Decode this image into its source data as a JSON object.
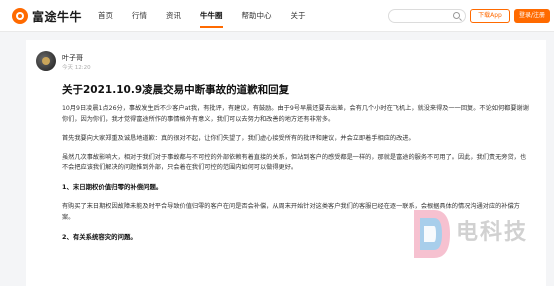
{
  "header": {
    "logo_text": "富途牛牛",
    "nav": [
      "首页",
      "行情",
      "资讯",
      "牛牛圈",
      "帮助中心",
      "关于"
    ],
    "search_placeholder": "",
    "download_label": "下载App",
    "login_label": "登录/注册"
  },
  "post": {
    "author": "叶子哥",
    "time": "今天 12:20",
    "title": "关于2021.10.9凌晨交易中断事故的道歉和回复",
    "paragraphs": [
      "10月9日凌晨1点26分，事故发生后不少客户at我，有批评，有建议，有鼓励。由于9号早晨还要去出差，会有几个小时在飞机上，就没来得及一一回复。不论如何都要谢谢你们，因为你们，我才觉得富途所作的事情格外有意义，我们可以去努力和改善的地方还有非常多。",
      "首先我要向大家郑重及诚恳地道歉：真的很对不起，让你们失望了，我们虚心接受所有的批评和建议，并会立即着手相应的改进。",
      "虽然几次事故影响大，相对于我们对于事故都与不可控的外部依赖有着直接的关系，但站到客户的感受都是一样的，那就是富途的服务不可用了。因此，我们责无旁贷，也不会把应该我们解决的问题推到外部，只会着在我们可控的范围内如何可以做得更好。"
    ],
    "section1_heading": "1、末日期权价值归零的补偿问题。",
    "section1_text": "有购买了末日期权因故障未能及时平合导致价值归零的客户在问是否会补偿，从周末开始针对这类客户我们的客服已经在逐一联系，会根据具体的情况沟通对应的补偿方案。",
    "section2_heading": "2、有关系统容灾的问题。"
  },
  "watermark": {
    "text": "电科技"
  }
}
